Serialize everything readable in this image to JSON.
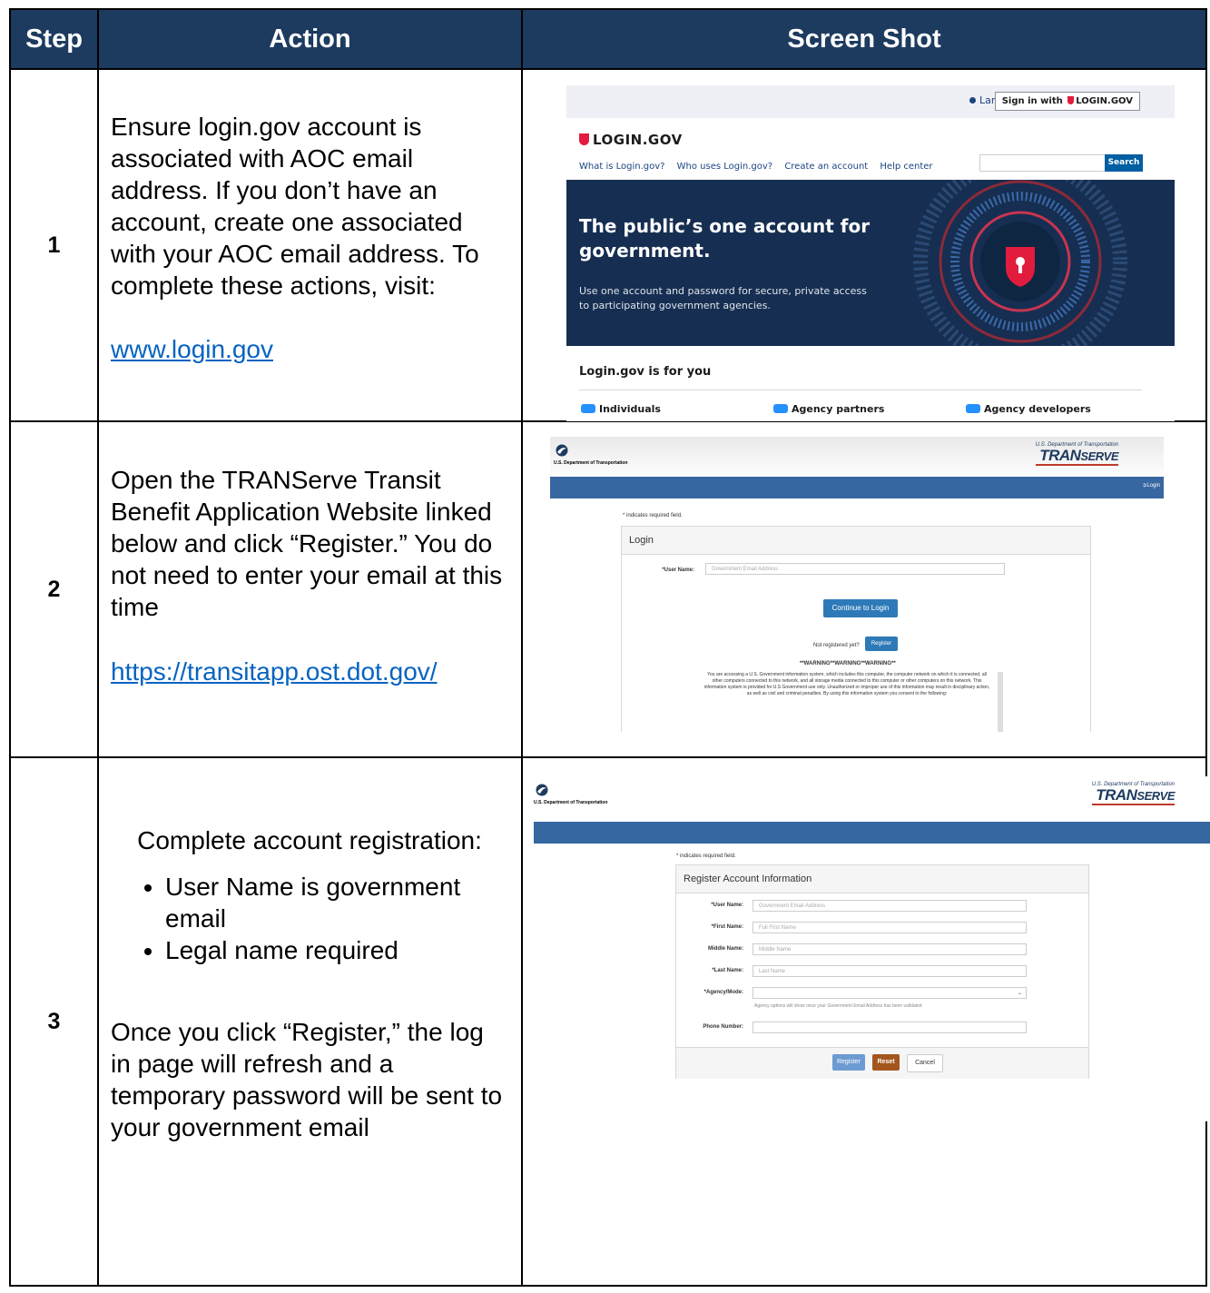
{
  "table": {
    "headers": {
      "step": "Step",
      "action": "Action",
      "screenshot": "Screen Shot"
    },
    "rows": [
      {
        "step": "1",
        "action": "Ensure login.gov account is associated with AOC email address. If you don’t have an account, create one associated with your AOC email address. To complete these actions, visit:",
        "link": "www.login.gov"
      },
      {
        "step": "2",
        "action": "Open the TRANServe Transit Benefit Application Website linked below and click “Register.” You do not need to enter your email at this time",
        "link": "https://transitapp.ost.dot.gov/"
      },
      {
        "step": "3",
        "action_intro": "Complete account registration:",
        "bullets": [
          "User Name is government email",
          "Legal name required"
        ],
        "action_outro": "Once you click “Register,” the log in page will refresh and a temporary password will be sent to your government email"
      }
    ]
  },
  "shot1": {
    "language": "Language",
    "signin": "Sign in with",
    "signin_brand": "LOGIN.GOV",
    "logo": "LOGIN.GOV",
    "nav": [
      "What is Login.gov?",
      "Who uses Login.gov?",
      "Create an account",
      "Help center"
    ],
    "search_button": "Search",
    "hero_title": "The public’s one account for government.",
    "hero_sub": "Use one account and password for secure, private access to participating government agencies.",
    "for_you": "Login.gov is for you",
    "categories": [
      "Individuals",
      "Agency partners",
      "Agency developers"
    ],
    "colors": {
      "hero": "#162e51",
      "accent": "#e21c3d",
      "link": "#1a4480"
    }
  },
  "shot2": {
    "dot_name": "U.S. Department of Transportation",
    "dept_small": "U.S. Department of Transportation",
    "brand_tran": "TRAN",
    "brand_serve": "SERVE",
    "login_link": "Login",
    "required_note": "* indicates required field.",
    "panel_title": "Login",
    "username_label": "*User Name:",
    "username_placeholder": "Government Email Address",
    "continue_button": "Continue to Login",
    "not_registered": "Not registered yet?",
    "register_button": "Register",
    "warning_title": "**WARNING**WARNING**WARNING**",
    "warning_text": "You are accessing a U.S. Government information system, which includes this computer, the computer network on which it is connected, all other computers connected to this network, and all storage media connected to this computer or other computers on this network. This information system is provided for U.S Government use only. Unauthorized or improper use of this information may result in disciplinary action, as well as civil and criminal penalties. By using this information system you consent to the following:"
  },
  "shot3": {
    "dot_name": "U.S. Department of Transportation",
    "dept_small": "U.S. Department of Transportation",
    "brand_tran": "TRAN",
    "brand_serve": "SERVE",
    "required_note": "* indicates required field.",
    "panel_title": "Register Account Information",
    "fields": [
      {
        "label": "*User Name:",
        "placeholder": "Government Email Address"
      },
      {
        "label": "*First Name:",
        "placeholder": "Full First Name"
      },
      {
        "label": "Middle Name:",
        "placeholder": "Middle Name"
      },
      {
        "label": "*Last Name:",
        "placeholder": "Last Name"
      },
      {
        "label": "*Agency/Mode:",
        "placeholder": ""
      },
      {
        "label": "Phone Number:",
        "placeholder": ""
      }
    ],
    "agency_hint": "Agency options will show once your Government Email Address has been validated",
    "buttons": {
      "register": "Register",
      "reset": "Reset",
      "cancel": "Cancel"
    }
  }
}
